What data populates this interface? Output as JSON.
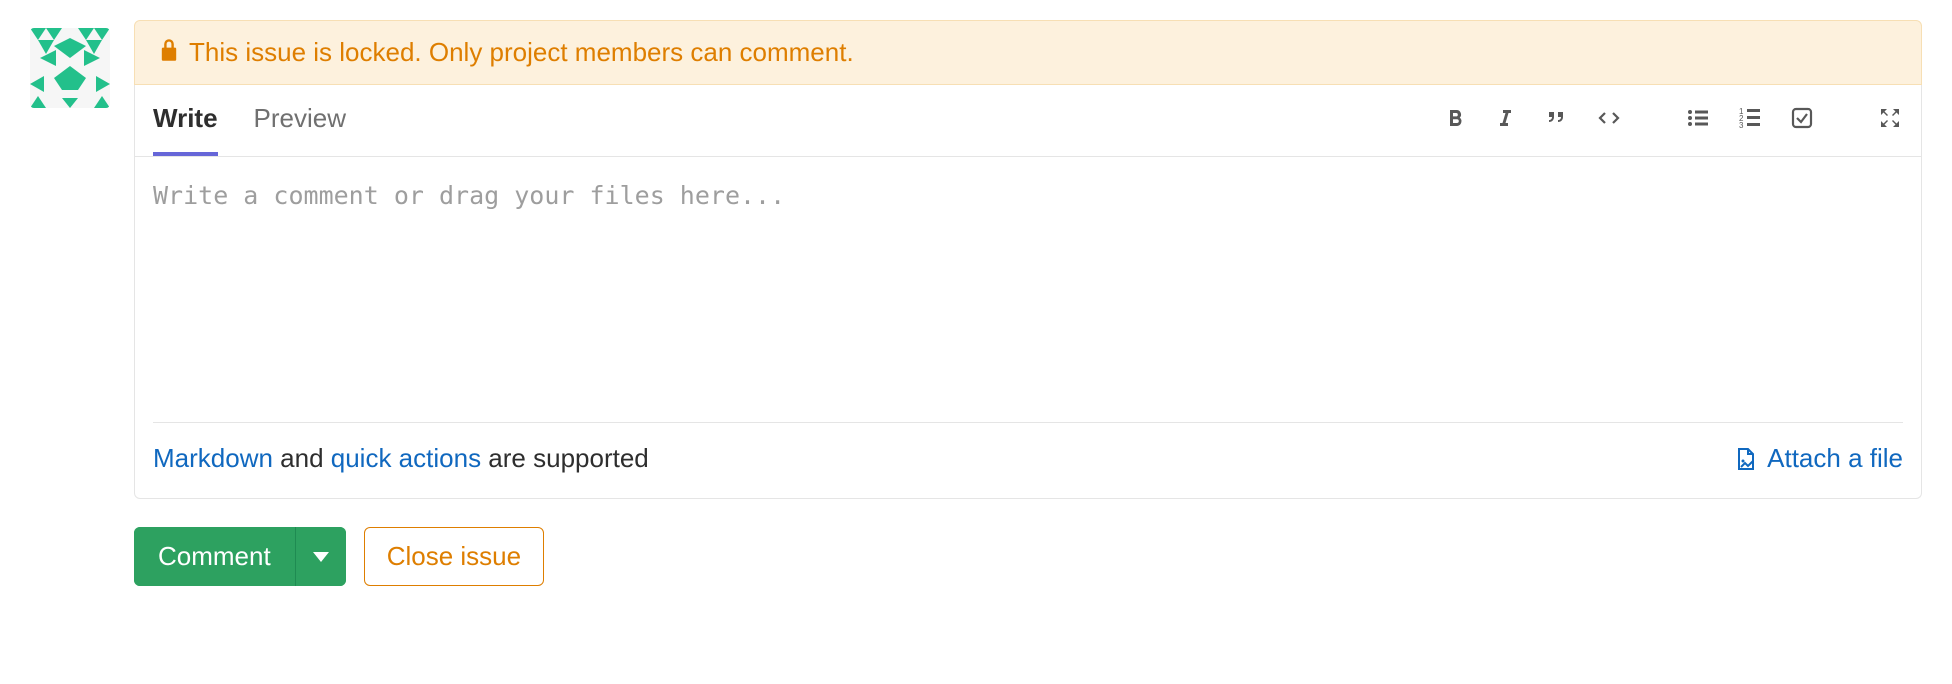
{
  "banner": {
    "text": "This issue is locked. Only project members can comment."
  },
  "tabs": {
    "write": "Write",
    "preview": "Preview",
    "active": "write"
  },
  "editor": {
    "placeholder": "Write a comment or drag your files here...",
    "value": ""
  },
  "footer": {
    "markdown_link": "Markdown",
    "mid_text": " and ",
    "quickactions_link": "quick actions",
    "tail_text": " are supported",
    "attach_label": "Attach a file"
  },
  "actions": {
    "comment_label": "Comment",
    "close_label": "Close issue"
  },
  "icons": {
    "bold": "bold-icon",
    "italic": "italic-icon",
    "quote": "quote-icon",
    "code": "code-icon",
    "ul": "bullet-list-icon",
    "ol": "numbered-list-icon",
    "task": "task-list-icon",
    "fullscreen": "fullscreen-icon"
  }
}
